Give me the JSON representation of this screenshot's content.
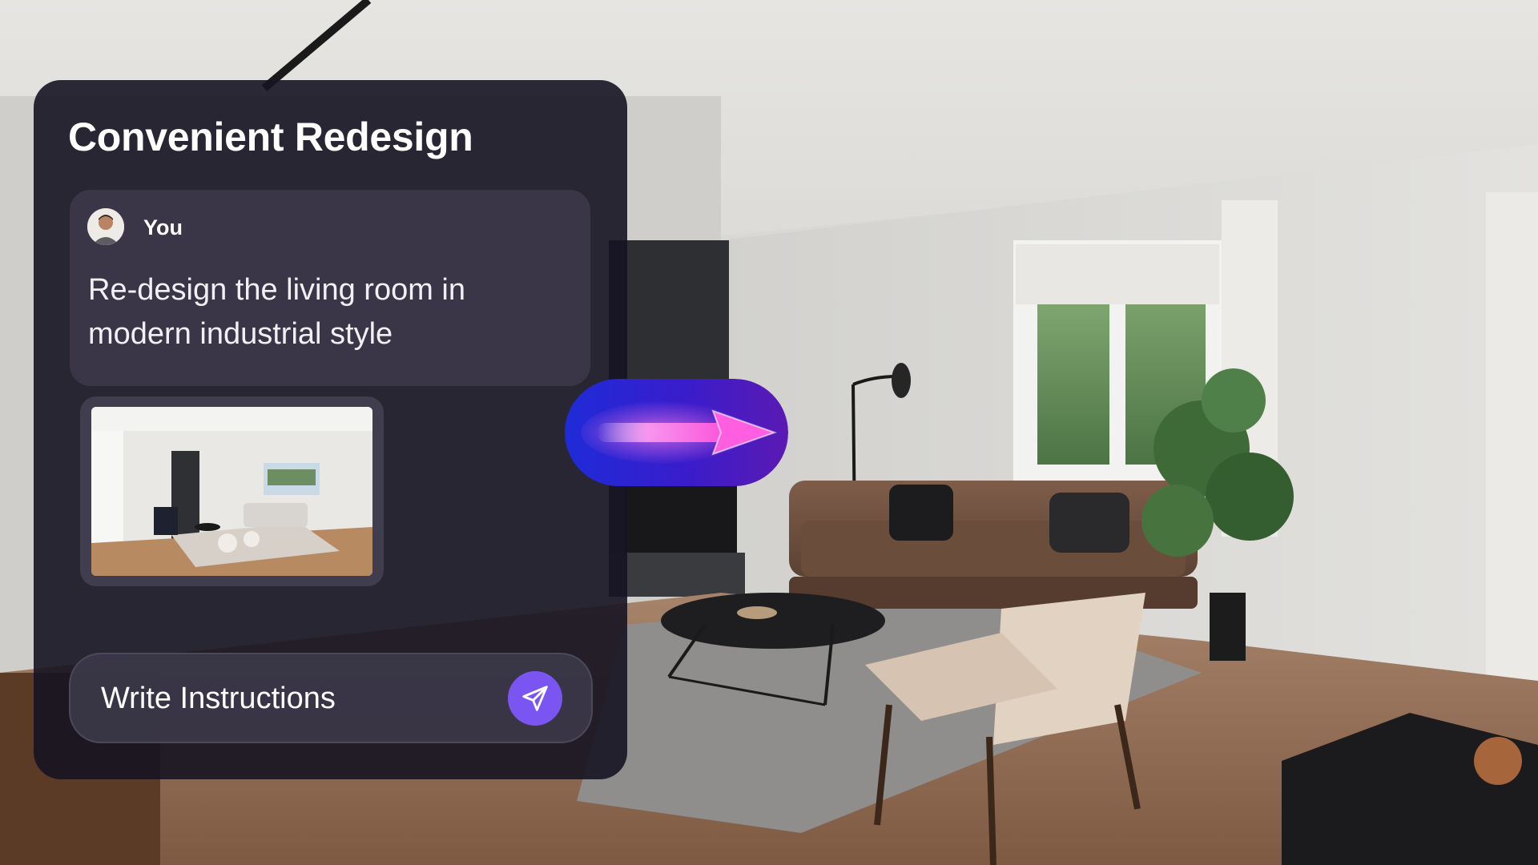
{
  "panel": {
    "title": "Convenient Redesign"
  },
  "message": {
    "author": "You",
    "text": "Re-design the living room in modern industrial style"
  },
  "input": {
    "placeholder": "Write Instructions"
  },
  "icons": {
    "send": "paper-plane-send-icon",
    "transform": "transform-arrow-icon"
  },
  "colors": {
    "panel_bg": "#161422",
    "accent": "#7b55f2",
    "arrow_gradient_start": "#2a33e0",
    "arrow_gradient_end": "#ff4fd8"
  }
}
